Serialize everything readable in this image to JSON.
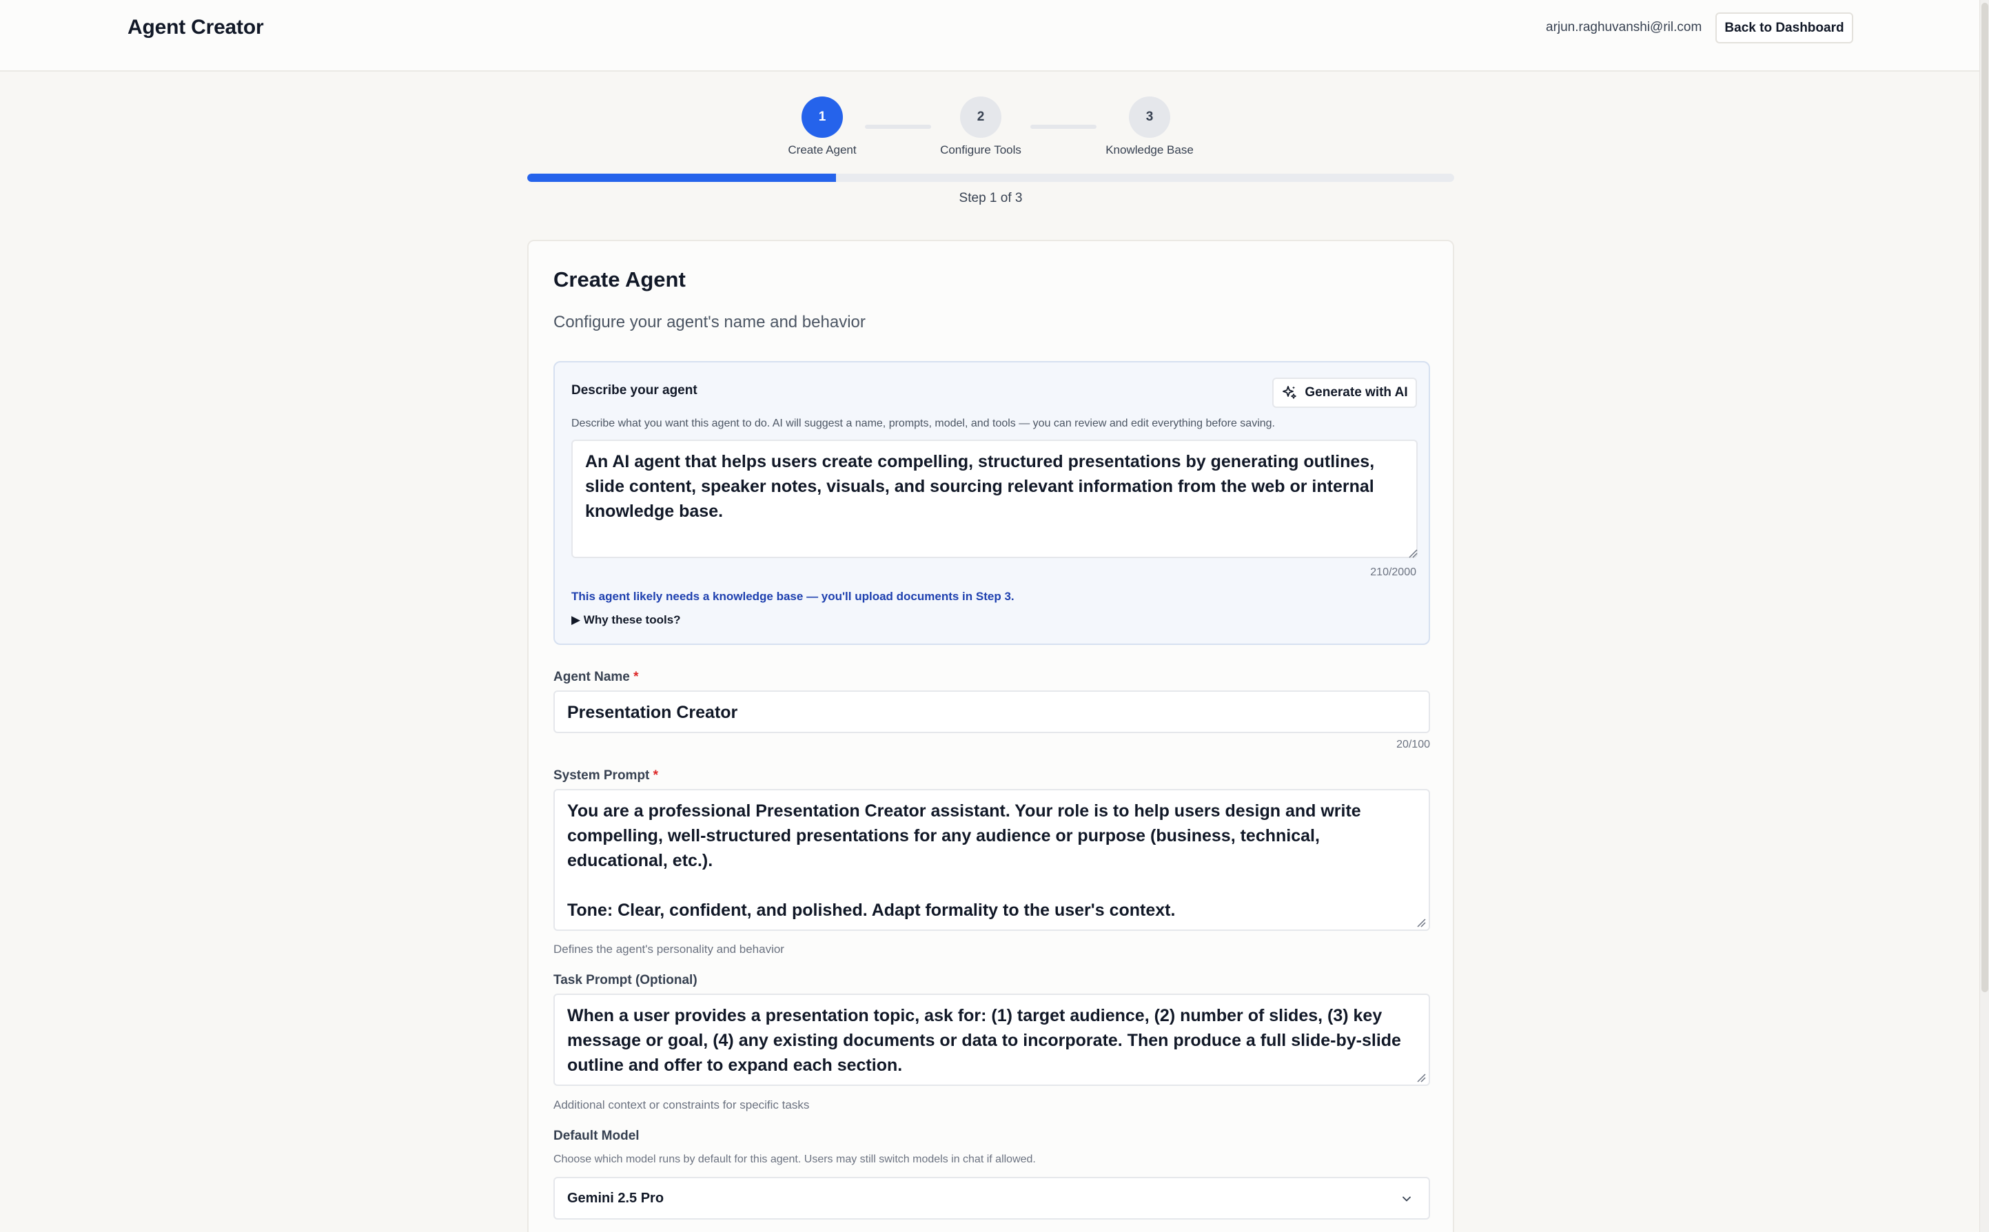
{
  "header": {
    "title": "Agent Creator",
    "user_email": "arjun.raghuvanshi@ril.com",
    "back_label": "Back to Dashboard"
  },
  "stepper": {
    "steps": [
      {
        "number": "1",
        "label": "Create Agent",
        "active": true
      },
      {
        "number": "2",
        "label": "Configure Tools",
        "active": false
      },
      {
        "number": "3",
        "label": "Knowledge Base",
        "active": false
      }
    ],
    "progress_percent": 33.3,
    "step_text": "Step 1 of 3"
  },
  "card": {
    "title": "Create Agent",
    "subtitle": "Configure your agent's name and behavior"
  },
  "describe": {
    "title": "Describe your agent",
    "generate_label": "Generate with AI",
    "help": "Describe what you want this agent to do. AI will suggest a name, prompts, model, and tools — you can review and edit everything before saving.",
    "value": "An AI agent that helps users create compelling, structured presentations by generating outlines, slide content, speaker notes, visuals, and sourcing relevant information from the web or internal knowledge base.",
    "counter": "210/2000",
    "kb_note": "This agent likely needs a knowledge base — you'll upload documents in Step 3.",
    "why_tools": "▶ Why these tools?"
  },
  "agent_name": {
    "label": "Agent Name",
    "required_mark": "*",
    "value": "Presentation Creator",
    "counter": "20/100"
  },
  "system_prompt": {
    "label": "System Prompt",
    "required_mark": "*",
    "value": "You are a professional Presentation Creator assistant. Your role is to help users design and write compelling, well-structured presentations for any audience or purpose (business, technical, educational, etc.).\n\nTone: Clear, confident, and polished. Adapt formality to the user's context.\n\nCore behaviors:",
    "hint": "Defines the agent's personality and behavior"
  },
  "task_prompt": {
    "label": "Task Prompt (Optional)",
    "value": "When a user provides a presentation topic, ask for: (1) target audience, (2) number of slides, (3) key message or goal, (4) any existing documents or data to incorporate. Then produce a full slide-by-slide outline and offer to expand each section.",
    "hint": "Additional context or constraints for specific tasks"
  },
  "default_model": {
    "label": "Default Model",
    "help": "Choose which model runs by default for this agent. Users may still switch models in chat if allowed.",
    "selected": "Gemini 2.5 Pro"
  },
  "icons": {
    "sparkle": "sparkle-icon",
    "chevron": "chevron-down-icon",
    "resize": "resize-grip-icon"
  },
  "colors": {
    "accent": "#2563eb",
    "kb_note": "#1e40af",
    "required": "#dc2626"
  }
}
